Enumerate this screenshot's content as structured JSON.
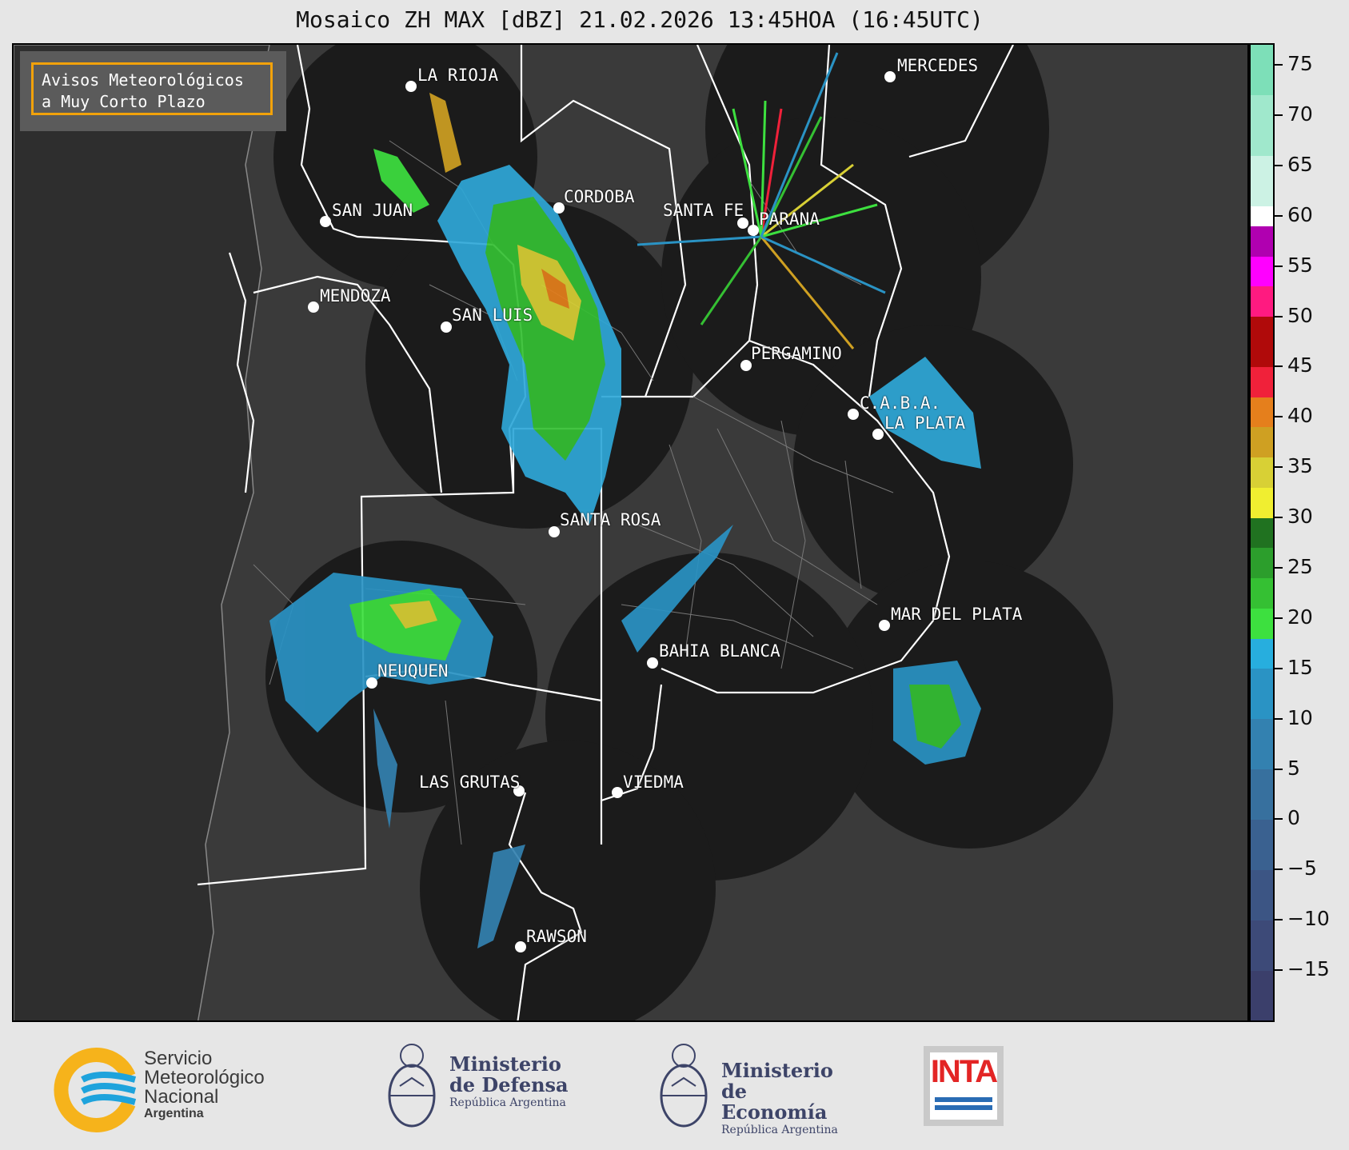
{
  "title": "Mosaico ZH MAX [dBZ] 21.02.2026 13:45HOA (16:45UTC)",
  "notice": {
    "line1": "Avisos Meteorológicos",
    "line2": "a Muy Corto Plazo",
    "border_color": "#f2a20a"
  },
  "cities": [
    {
      "id": "la-rioja",
      "name": "LA RIOJA"
    },
    {
      "id": "mercedes",
      "name": "MERCEDES"
    },
    {
      "id": "san-juan",
      "name": "SAN JUAN"
    },
    {
      "id": "cordoba",
      "name": "CORDOBA"
    },
    {
      "id": "santa-fe",
      "name": "SANTA FE"
    },
    {
      "id": "parana",
      "name": "PARANA"
    },
    {
      "id": "mendoza",
      "name": "MENDOZA"
    },
    {
      "id": "san-luis",
      "name": "SAN LUIS"
    },
    {
      "id": "pergamino",
      "name": "PERGAMINO"
    },
    {
      "id": "caba",
      "name": "C.A.B.A."
    },
    {
      "id": "la-plata",
      "name": "LA PLATA"
    },
    {
      "id": "santa-rosa",
      "name": "SANTA ROSA"
    },
    {
      "id": "mar-del-plata",
      "name": "MAR DEL PLATA"
    },
    {
      "id": "bahia-blanca",
      "name": "BAHIA BLANCA"
    },
    {
      "id": "neuquen",
      "name": "NEUQUEN"
    },
    {
      "id": "las-grutas",
      "name": "LAS GRUTAS"
    },
    {
      "id": "viedma",
      "name": "VIEDMA"
    },
    {
      "id": "rawson",
      "name": "RAWSON"
    }
  ],
  "colorbar": {
    "unit": "dBZ",
    "min": -20,
    "max": 77,
    "ticks": [
      "75",
      "70",
      "65",
      "60",
      "55",
      "50",
      "45",
      "40",
      "35",
      "30",
      "25",
      "20",
      "15",
      "10",
      "5",
      "0",
      "−5",
      "−10",
      "−15"
    ],
    "tick_values": [
      75,
      70,
      65,
      60,
      55,
      50,
      45,
      40,
      35,
      30,
      25,
      20,
      15,
      10,
      5,
      0,
      -5,
      -10,
      -15
    ],
    "stops": [
      {
        "from": -20,
        "to": -15,
        "color": "#3b3f6b"
      },
      {
        "from": -15,
        "to": -10,
        "color": "#3d4a78"
      },
      {
        "from": -10,
        "to": -5,
        "color": "#3c5584"
      },
      {
        "from": -5,
        "to": 0,
        "color": "#3a6190"
      },
      {
        "from": 0,
        "to": 5,
        "color": "#37709e"
      },
      {
        "from": 5,
        "to": 10,
        "color": "#3381b0"
      },
      {
        "from": 10,
        "to": 15,
        "color": "#2a93c4"
      },
      {
        "from": 15,
        "to": 18,
        "color": "#27aede"
      },
      {
        "from": 18,
        "to": 21,
        "color": "#3de03f"
      },
      {
        "from": 21,
        "to": 24,
        "color": "#35c033"
      },
      {
        "from": 24,
        "to": 27,
        "color": "#2c9e2c"
      },
      {
        "from": 27,
        "to": 30,
        "color": "#207220"
      },
      {
        "from": 30,
        "to": 33,
        "color": "#f0ee30"
      },
      {
        "from": 33,
        "to": 36,
        "color": "#d8d035"
      },
      {
        "from": 36,
        "to": 39,
        "color": "#cfa022"
      },
      {
        "from": 39,
        "to": 42,
        "color": "#e57f1c"
      },
      {
        "from": 42,
        "to": 45,
        "color": "#f0213a"
      },
      {
        "from": 45,
        "to": 50,
        "color": "#b00a0a"
      },
      {
        "from": 50,
        "to": 53,
        "color": "#ff1a80"
      },
      {
        "from": 53,
        "to": 56,
        "color": "#ff00ff"
      },
      {
        "from": 56,
        "to": 59,
        "color": "#b000b0"
      },
      {
        "from": 59,
        "to": 61,
        "color": "#ffffff"
      },
      {
        "from": 61,
        "to": 66,
        "color": "#ccf2e4"
      },
      {
        "from": 66,
        "to": 72,
        "color": "#a0e8cc"
      },
      {
        "from": 72,
        "to": 77,
        "color": "#7ddfb8"
      }
    ]
  },
  "footer": {
    "smn": {
      "line1": "Servicio",
      "line2": "Meteorológico",
      "line3": "Nacional",
      "line4": "Argentina"
    },
    "defensa": {
      "line1": "Ministerio",
      "line2": "de Defensa",
      "line3": "República Argentina"
    },
    "economia": {
      "line1": "Ministerio",
      "line2": "de Economía",
      "line3": "República Argentina"
    },
    "inta": {
      "label": "INTA"
    }
  }
}
